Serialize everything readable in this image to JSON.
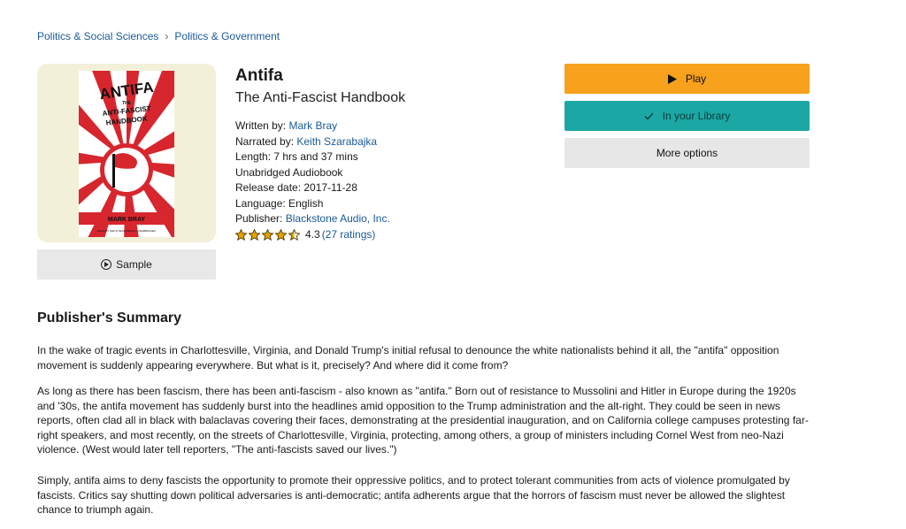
{
  "breadcrumb": {
    "items": [
      "Politics & Social Sciences",
      "Politics & Government"
    ],
    "separator": "›"
  },
  "cover": {
    "title_top": "ANTIFA",
    "title_mid": "THE",
    "title_sub1": "ANTI-FASCIST",
    "title_sub2": "HANDBOOK",
    "author_band": "MARK BRAY",
    "small_print": "READ BY KEITH SZARABAJKA • UNABRIDGED"
  },
  "sample": {
    "label": "Sample",
    "icon": "play-circle-icon"
  },
  "book": {
    "title": "Antifa",
    "subtitle": "The Anti-Fascist Handbook",
    "written_by_label": "Written by:",
    "author": "Mark Bray",
    "narrated_by_label": "Narrated by:",
    "narrator": "Keith Szarabajka",
    "length": "Length: 7 hrs and 37 mins",
    "format": "Unabridged Audiobook",
    "release_date": "Release date: 2017-11-28",
    "language": "Language: English",
    "publisher_label": "Publisher:",
    "publisher": "Blackstone Audio, Inc.",
    "rating_value": "4.3",
    "rating_stars": 4.5,
    "rating_count": "(27 ratings)"
  },
  "actions": {
    "play_label": "Play",
    "library_label": "In your Library",
    "more_label": "More options"
  },
  "colors": {
    "play_bg": "#f7a11d",
    "library_bg": "#1ba8a4",
    "more_bg": "#e7e7e7",
    "link": "#1a5a96",
    "star": "#e8a200"
  },
  "summary": {
    "heading": "Publisher's Summary",
    "p1": "In the wake of tragic events in Charlottesville, Virginia, and Donald Trump's initial refusal to denounce the white nationalists behind it all, the \"antifa\" opposition movement is suddenly appearing everywhere. But what is it, precisely? And where did it come from?",
    "p2": "As long as there has been fascism, there has been anti-fascism - also known as \"antifa.\" Born out of resistance to Mussolini and Hitler in Europe during the 1920s and '30s, the antifa movement has suddenly burst into the headlines amid opposition to the Trump administration and the alt-right. They could be seen in news reports, often clad all in black with balaclavas covering their faces, demonstrating at the presidential inauguration, and on California college campuses protesting far-right speakers, and most recently, on the streets of Charlottesville, Virginia, protecting, among others, a group of ministers including Cornel West from neo-Nazi violence. (West would later tell reporters, \"The anti-fascists saved our lives.\")",
    "p3": "Simply, antifa aims to deny fascists the opportunity to promote their oppressive politics, and to protect tolerant communities from acts of violence promulgated by fascists. Critics say shutting down political adversaries is anti-democratic; antifa adherents argue that the horrors of fascism must never be allowed the slightest chance to triumph again."
  }
}
